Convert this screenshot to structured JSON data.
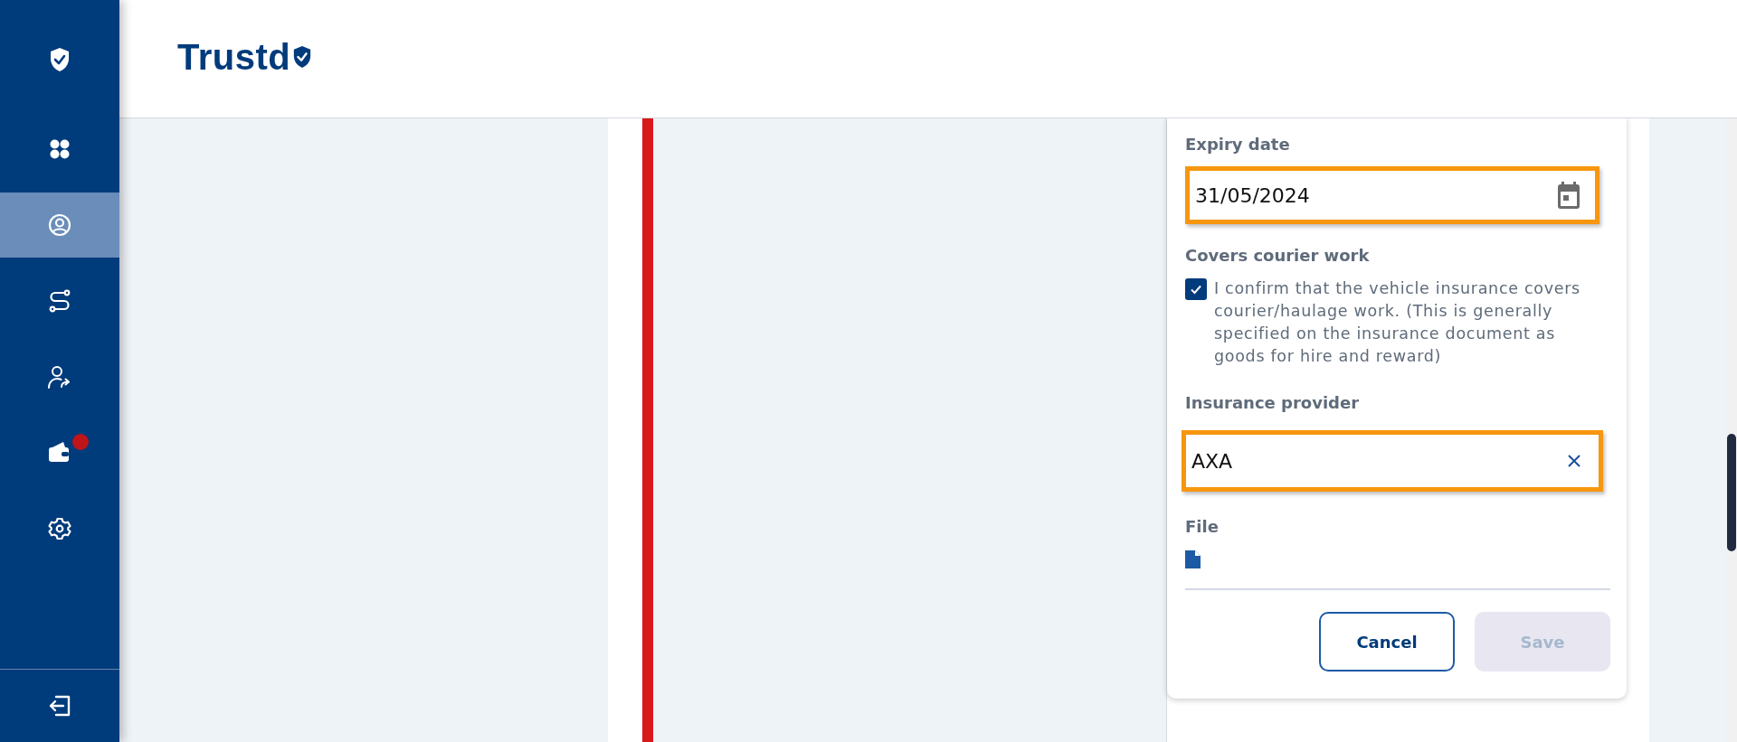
{
  "sidebar": {
    "items": [
      {
        "kind": "dashboard",
        "selected": false,
        "notification": false
      },
      {
        "kind": "profile",
        "selected": true,
        "notification": false
      },
      {
        "kind": "route",
        "selected": false,
        "notification": false
      },
      {
        "kind": "referral",
        "selected": false,
        "notification": false
      },
      {
        "kind": "wallet",
        "selected": false,
        "notification": true
      },
      {
        "kind": "settings",
        "selected": false,
        "notification": false
      }
    ]
  },
  "header": {
    "logo": "Trustd"
  },
  "form": {
    "expiry_date": {
      "label": "Expiry date",
      "value": "31/05/2024",
      "highlighted": true
    },
    "courier_work": {
      "label": "Covers courier work",
      "checked": true,
      "text": "I confirm that the vehicle insurance covers courier/haulage work. (This is generally specified on the insurance document as goods for hire and reward)"
    },
    "insurance_provider": {
      "label": "Insurance provider",
      "value": "AXA",
      "highlighted": true
    },
    "file": {
      "label": "File"
    },
    "buttons": [
      {
        "label": "Cancel",
        "kind": "secondary",
        "disabled": false
      },
      {
        "label": "Save",
        "kind": "primary",
        "disabled": true
      }
    ]
  }
}
